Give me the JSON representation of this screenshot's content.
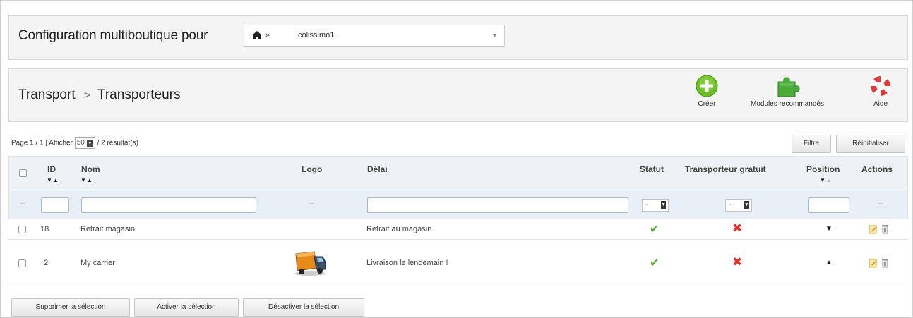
{
  "shop_config": {
    "label": "Configuration multiboutique pour",
    "selector_separator": "»",
    "selected_shop": "colissimo1",
    "home_icon": "home-icon",
    "caret_icon": "chevron-down-icon"
  },
  "header": {
    "breadcrumb_parent": "Transport",
    "breadcrumb_separator": ">",
    "breadcrumb_current": "Transporteurs",
    "toolbar": {
      "create_label": "Créer",
      "modules_label": "Modules recommandés",
      "help_label": "Aide"
    }
  },
  "pager": {
    "prefix": "Page",
    "current_page": "1",
    "total_pages": "/ 1 | Afficher",
    "per_page": "50",
    "result_text": "/ 2 résultat(s)",
    "filter_button": "Filtre",
    "reset_button": "Réinitialiser"
  },
  "table": {
    "columns": {
      "id": "ID",
      "name": "Nom",
      "logo": "Logo",
      "delay": "Délai",
      "status": "Statut",
      "free_shipping": "Transporteur gratuit",
      "position": "Position",
      "actions": "Actions"
    },
    "filter_placeholders": {
      "logo": "--",
      "actions": "--",
      "checkbox": "--",
      "status_select": "-",
      "free_select": "-"
    },
    "rows": [
      {
        "id": "18",
        "name": "Retrait magasin",
        "delay": "Retrait au magasin",
        "status": "enabled",
        "free": "disabled",
        "position_arrow": "down",
        "has_logo": false
      },
      {
        "id": "2",
        "name": "My carrier",
        "delay": "Livraison le lendemain !",
        "status": "enabled",
        "free": "disabled",
        "position_arrow": "up",
        "has_logo": true
      }
    ]
  },
  "bulk_actions": {
    "delete": "Supprimer la sélection",
    "enable": "Activer la sélection",
    "disable": "Désactiver la sélection"
  },
  "colors": {
    "panel_bg": "#f4f4f4",
    "header_row_bg": "#eef1f5",
    "filter_row_bg": "#e8eff6",
    "enabled_green": "#5aa43a",
    "disabled_red": "#e0332e",
    "create_green": "#6cc024"
  }
}
